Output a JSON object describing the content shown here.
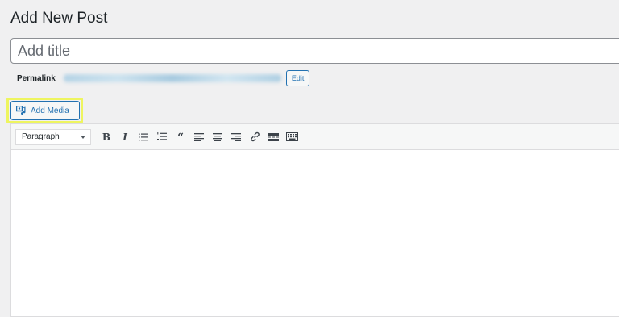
{
  "page": {
    "title": "Add New Post"
  },
  "post": {
    "title_placeholder": "Add title",
    "title_value": ""
  },
  "permalink": {
    "label": "Permalink",
    "edit_label": "Edit"
  },
  "media": {
    "add_media_label": "Add Media",
    "highlight_color": "#eef55f"
  },
  "toolbar": {
    "format_selected": "Paragraph",
    "buttons": [
      "bold-icon",
      "italic-icon",
      "bulleted-list-icon",
      "numbered-list-icon",
      "blockquote-icon",
      "align-left-icon",
      "align-center-icon",
      "align-right-icon",
      "link-icon",
      "read-more-icon",
      "toolbar-toggle-icon"
    ]
  },
  "colors": {
    "accent": "#2271b1",
    "background": "#f0f0f1",
    "text": "#1d2327"
  }
}
